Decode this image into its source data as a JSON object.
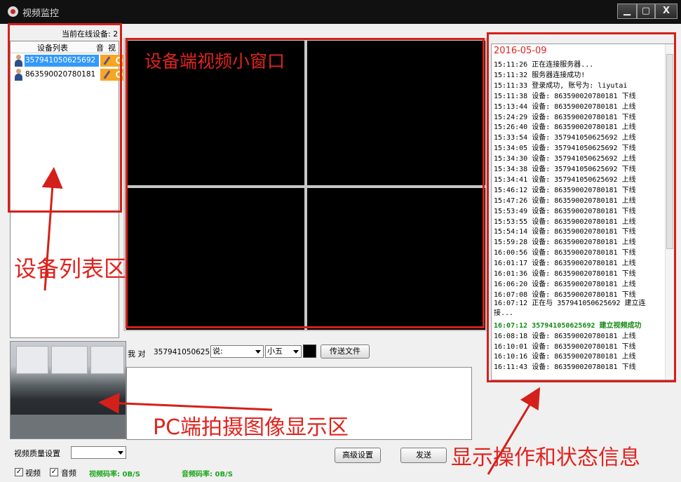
{
  "window": {
    "title": "视频监控",
    "min_glyph": "▁",
    "max_glyph": "▢",
    "close_glyph": "X"
  },
  "device_panel": {
    "online_label": "当前在线设备: 2",
    "headers": {
      "list": "设备列表",
      "audio": "音",
      "video": "视"
    },
    "devices": [
      {
        "id": "357941050625692",
        "selected": true
      },
      {
        "id": "863590020780181",
        "selected": false
      }
    ]
  },
  "chat": {
    "me_label": "我 对",
    "target_id": "357941050625692",
    "font_value": "说:",
    "size_value": "小五",
    "color": "#000000",
    "send_file_label": "传送文件",
    "send_label": "发送",
    "advanced_label": "高级设置"
  },
  "settings": {
    "quality_label": "视频质量设置",
    "video_checkbox_label": "视频",
    "audio_checkbox_label": "音频",
    "video_checked": true,
    "audio_checked": true,
    "video_rate": "视频码率: 0B/S",
    "audio_rate": "音频码率: 0B/S"
  },
  "log": {
    "date": "2016-05-09",
    "lines": [
      {
        "time": "15:11:26",
        "text": "正在连接服务器..."
      },
      {
        "time": "15:11:32",
        "text": "服务器连接成功!"
      },
      {
        "time": "15:11:33",
        "text": "登录成功, 账号为: liyutai"
      },
      {
        "time": "15:11:38",
        "text": "设备: 863590020780181 下线"
      },
      {
        "time": "15:13:44",
        "text": "设备: 863590020780181 上线"
      },
      {
        "time": "15:24:29",
        "text": "设备: 863590020780181 下线"
      },
      {
        "time": "15:26:40",
        "text": "设备: 863590020780181 上线"
      },
      {
        "time": "15:33:54",
        "text": "设备: 357941050625692 上线"
      },
      {
        "time": "15:34:05",
        "text": "设备: 357941050625692 下线"
      },
      {
        "time": "15:34:30",
        "text": "设备: 357941050625692 上线"
      },
      {
        "time": "15:34:38",
        "text": "设备: 357941050625692 下线"
      },
      {
        "time": "15:34:41",
        "text": "设备: 357941050625692 上线"
      },
      {
        "time": "15:46:12",
        "text": "设备: 863590020780181 下线"
      },
      {
        "time": "15:47:26",
        "text": "设备: 863590020780181 上线"
      },
      {
        "time": "15:53:49",
        "text": "设备: 863590020780181 下线"
      },
      {
        "time": "15:53:55",
        "text": "设备: 863590020780181 上线"
      },
      {
        "time": "15:54:14",
        "text": "设备: 863590020780181 下线"
      },
      {
        "time": "15:59:28",
        "text": "设备: 863590020780181 上线"
      },
      {
        "time": "16:00:56",
        "text": "设备: 863590020780181 下线"
      },
      {
        "time": "16:01:17",
        "text": "设备: 863590020780181 上线"
      },
      {
        "time": "16:01:36",
        "text": "设备: 863590020780181 下线"
      },
      {
        "time": "16:06:20",
        "text": "设备: 863590020780181 上线"
      },
      {
        "time": "16:07:08",
        "text": "设备: 863590020780181 下线"
      },
      {
        "time": "16:07:12",
        "text": "正在与 357941050625692 建立连接...",
        "wrap": true
      },
      {
        "time": "16:07:12",
        "text": "357941050625692 建立视频成功",
        "ok": true
      },
      {
        "time": "16:08:18",
        "text": "设备: 863590020780181 上线"
      },
      {
        "time": "16:10:01",
        "text": "设备: 863590020780181 下线"
      },
      {
        "time": "16:10:16",
        "text": "设备: 863590020780181 上线"
      },
      {
        "time": "16:11:43",
        "text": "设备: 863590020780181 下线"
      }
    ]
  },
  "annotations": {
    "device_list": "设备列表区",
    "video_windows": "设备端视频小窗口",
    "pc_capture": "PC端拍摄图像显示区",
    "status_info": "显示操作和状态信息"
  },
  "colors": {
    "annotation_red": "#e0241f",
    "selection_blue": "#3399ff",
    "rate_green": "#1ea61e",
    "log_success_green": "#128a12"
  }
}
